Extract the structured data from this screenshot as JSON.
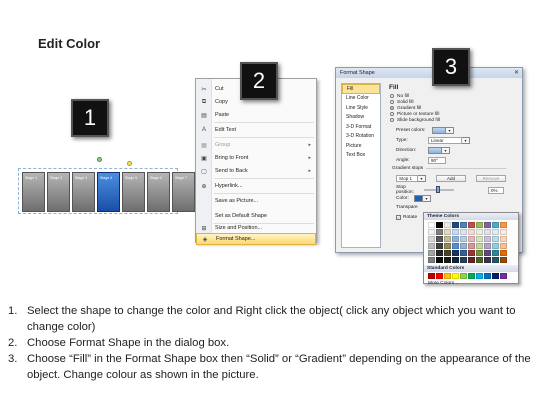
{
  "page_title": "Edit Color",
  "badges": [
    "1",
    "2",
    "3"
  ],
  "shape_strip": {
    "labels": [
      "Stage 1",
      "Stage 2",
      "Stage 3",
      "Stage 4",
      "Stage 5",
      "Stage 6",
      "Stage 7"
    ],
    "selected_index": 3
  },
  "context_menu": {
    "items": [
      {
        "label": "Cut",
        "icon": "scissors-icon"
      },
      {
        "label": "Copy",
        "icon": "copy-icon"
      },
      {
        "label": "Paste",
        "icon": "paste-icon"
      },
      {
        "label": "Edit Text",
        "icon": "edit-text-icon"
      },
      {
        "label": "Group",
        "icon": "group-icon",
        "submenu": true
      },
      {
        "label": "Bring to Front",
        "icon": "bring-front-icon",
        "submenu": true
      },
      {
        "label": "Send to Back",
        "icon": "send-back-icon",
        "submenu": true
      },
      {
        "label": "Hyperlink...",
        "icon": "hyperlink-icon"
      },
      {
        "label": "Save as Picture...",
        "icon": ""
      },
      {
        "label": "Set as Default Shape",
        "icon": ""
      },
      {
        "label": "Size and Position...",
        "icon": "size-icon"
      },
      {
        "label": "Format Shape...",
        "icon": "format-shape-icon",
        "highlighted": true
      }
    ]
  },
  "dialog": {
    "title": "Format Shape",
    "categories": [
      "Fill",
      "Line Color",
      "Line Style",
      "Shadow",
      "3-D Format",
      "3-D Rotation",
      "Picture",
      "Text Box"
    ],
    "selected_category": "Fill",
    "fill_heading": "Fill",
    "fill_options": [
      "No fill",
      "Solid fill",
      "Gradient fill",
      "Picture or texture fill",
      "Slide background fill"
    ],
    "selected_fill": "Gradient fill",
    "preset_colors_label": "Preset colors:",
    "type_label": "Type:",
    "type_value": "Linear",
    "direction_label": "Direction:",
    "angle_label": "Angle:",
    "angle_value": "90°",
    "gradient_stops_label": "Gradient stops",
    "stop_value": "Stop 1",
    "add_label": "Add",
    "remove_label": "Remove",
    "stop_position_label": "Stop position:",
    "stop_position_value": "0%",
    "color_label": "Color:",
    "transparency_label": "Transpare",
    "rotate_label": "Rotate"
  },
  "palette": {
    "theme_label": "Theme Colors",
    "standard_label": "Standard Colors",
    "more_label": "More Colors...",
    "theme_colors": [
      [
        "#ffffff",
        "#000000",
        "#eeece1",
        "#1f497d",
        "#4f81bd",
        "#c0504d",
        "#9bbb59",
        "#8064a2",
        "#4bacc6",
        "#f79646"
      ],
      [
        "#f2f2f2",
        "#7f7f7f",
        "#ddd9c3",
        "#c6d9f0",
        "#dbe5f1",
        "#f2dcdb",
        "#ebf1dd",
        "#e5e0ec",
        "#dbeef3",
        "#fdeada"
      ],
      [
        "#d8d8d8",
        "#595959",
        "#c4bd97",
        "#8db3e2",
        "#b8cce4",
        "#e5b9b7",
        "#d7e3bc",
        "#ccc1d9",
        "#b7dde8",
        "#fbd5b5"
      ],
      [
        "#bfbfbf",
        "#3f3f3f",
        "#938953",
        "#548dd4",
        "#95b3d7",
        "#d99694",
        "#c3d69b",
        "#b2a2c7",
        "#92cddc",
        "#fac08f"
      ],
      [
        "#a5a5a5",
        "#262626",
        "#494429",
        "#17365d",
        "#366092",
        "#953734",
        "#76923c",
        "#5f497a",
        "#31859b",
        "#e36c09"
      ],
      [
        "#7f7f7f",
        "#0c0c0c",
        "#1d1b10",
        "#0f243e",
        "#244061",
        "#632423",
        "#4f6128",
        "#3f3151",
        "#205867",
        "#974806"
      ]
    ],
    "standard_colors": [
      "#c00000",
      "#ff0000",
      "#ffc000",
      "#ffff00",
      "#92d050",
      "#00b050",
      "#00b0f0",
      "#0070c0",
      "#002060",
      "#7030a0"
    ]
  },
  "instructions": [
    {
      "num": "1.",
      "text": "Select the shape to change the color and Right click the object( click any object which you want to change color)"
    },
    {
      "num": "2.",
      "text": "Choose Format Shape in the dialog box."
    },
    {
      "num": "3.",
      "text": "Choose “Fill” in the Format Shape box then “Solid” or “Gradient” depending on the appearance of the object. Change colour as shown in the picture."
    }
  ]
}
